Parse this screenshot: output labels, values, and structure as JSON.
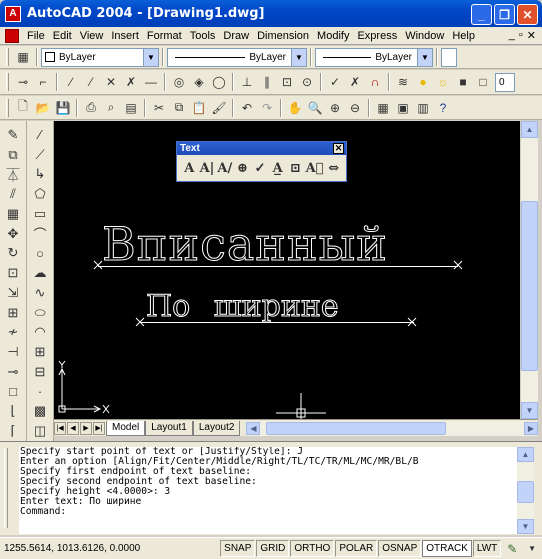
{
  "window": {
    "title": "AutoCAD 2004 - [Drawing1.dwg]",
    "app_icon": "A",
    "buttons": [
      "_",
      "❐",
      "✕"
    ]
  },
  "menu": {
    "items": [
      "File",
      "Edit",
      "View",
      "Insert",
      "Format",
      "Tools",
      "Draw",
      "Dimension",
      "Modify",
      "Express",
      "Window",
      "Help"
    ],
    "mdi_buttons": [
      "_",
      "▫",
      "✕"
    ]
  },
  "properties": {
    "color": "ByLayer",
    "linetype": "ByLayer",
    "lineweight": "ByLayer",
    "layer_value": "0"
  },
  "text_toolbar": {
    "title": "Text",
    "close": "✕"
  },
  "drawing": {
    "big_text": "Вписанный",
    "small_text": "По ширине",
    "background": "#000000",
    "text_color": "#ffffff"
  },
  "layout_tabs": [
    "Model",
    "Layout1",
    "Layout2"
  ],
  "command_lines": [
    "Specify start point of text or [Justify/Style]: J",
    "Enter an option [Align/Fit/Center/Middle/Right/TL/TC/TR/ML/MC/MR/BL/B",
    "Specify first endpoint of text baseline:",
    "Specify second endpoint of text baseline:",
    "Specify height <4.0000>: 3",
    "Enter text: По ширине",
    "Command:"
  ],
  "status": {
    "coordinates": "1255.5614, 1013.6126, 0.0000",
    "buttons": [
      "SNAP",
      "GRID",
      "ORTHO",
      "POLAR",
      "OSNAP",
      "OTRACK",
      "LWT"
    ],
    "active": [
      "OTRACK"
    ]
  }
}
